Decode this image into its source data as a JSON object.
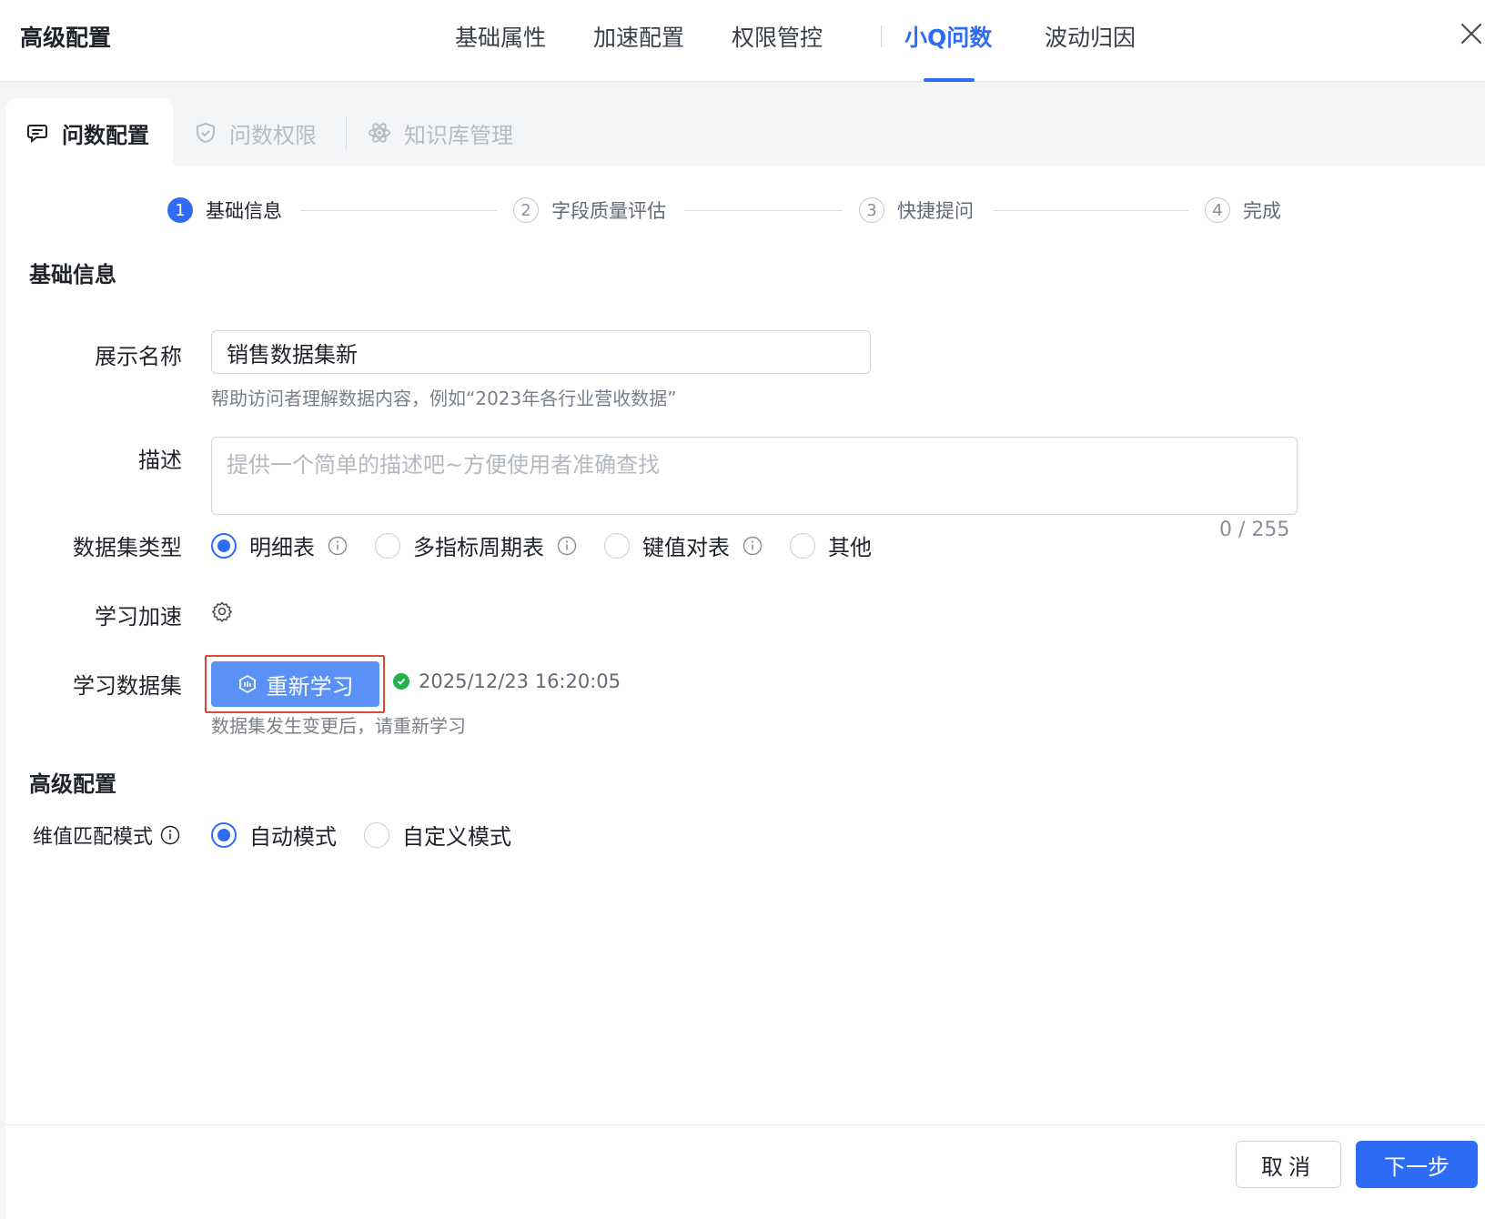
{
  "header": {
    "title": "高级配置",
    "tabs": [
      {
        "label": "基础属性"
      },
      {
        "label": "加速配置"
      },
      {
        "label": "权限管控"
      },
      {
        "label": "小Q问数"
      },
      {
        "label": "波动归因"
      }
    ],
    "active_tab": "小Q问数"
  },
  "subtabs": {
    "items": [
      {
        "label": "问数配置",
        "icon": "chat-icon"
      },
      {
        "label": "问数权限",
        "icon": "shield-icon"
      },
      {
        "label": "知识库管理",
        "icon": "atom-icon"
      }
    ],
    "active": "问数配置"
  },
  "steps": [
    {
      "num": "1",
      "label": "基础信息"
    },
    {
      "num": "2",
      "label": "字段质量评估"
    },
    {
      "num": "3",
      "label": "快捷提问"
    },
    {
      "num": "4",
      "label": "完成"
    }
  ],
  "basic": {
    "section_title": "基础信息",
    "name_label": "展示名称",
    "name_value": "销售数据集新",
    "name_hint": "帮助访问者理解数据内容，例如“2023年各行业营收数据”",
    "desc_label": "描述",
    "desc_placeholder": "提供一个简单的描述吧~方便使用者准确查找",
    "desc_counter": "0 / 255",
    "type_label": "数据集类型",
    "type_options": [
      {
        "label": "明细表"
      },
      {
        "label": "多指标周期表"
      },
      {
        "label": "键值对表"
      },
      {
        "label": "其他"
      }
    ],
    "accel_label": "学习加速",
    "learn_label": "学习数据集",
    "relearn_button": "重新学习",
    "learn_timestamp": "2025/12/23 16:20:05",
    "learn_hint": "数据集发生变更后，请重新学习"
  },
  "advanced": {
    "section_title": "高级配置",
    "match_label": "维值匹配模式",
    "match_options": [
      {
        "label": "自动模式"
      },
      {
        "label": "自定义模式"
      }
    ]
  },
  "footer": {
    "cancel_label": "取消",
    "next_label": "下一步"
  },
  "colors": {
    "accent": "#2f6cf6",
    "button_soft": "#5b90f7",
    "highlight": "#e0483a",
    "success": "#23b14d"
  }
}
